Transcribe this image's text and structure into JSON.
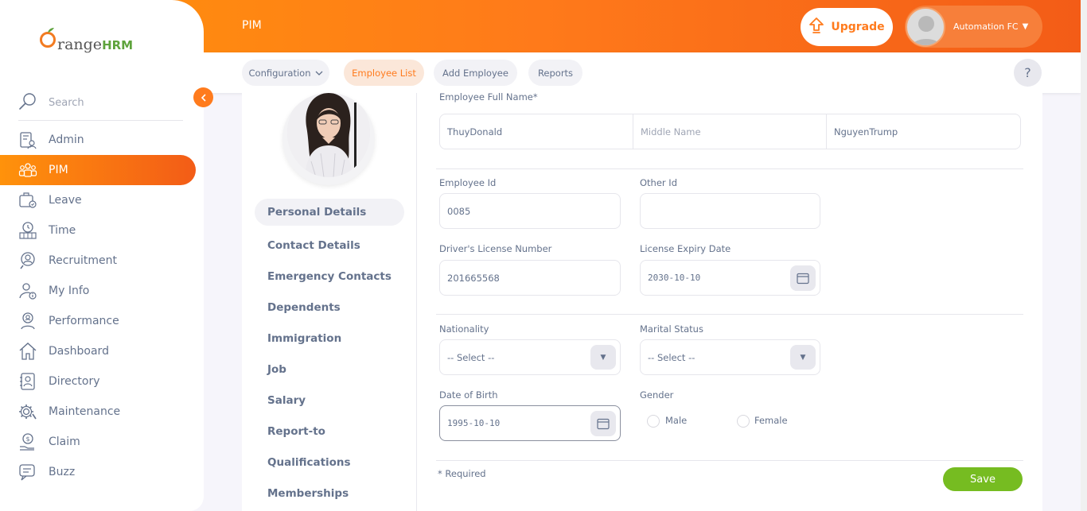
{
  "header": {
    "title": "PIM",
    "upgrade_label": "Upgrade",
    "user_name": "Automation FC"
  },
  "subnav": {
    "configuration": "Configuration",
    "employee_list": "Employee List",
    "add_employee": "Add Employee",
    "reports": "Reports",
    "help": "?"
  },
  "sidebar": {
    "brand": "range",
    "brand_hrm": "HRM",
    "search_placeholder": "Search",
    "items": [
      {
        "label": "Admin"
      },
      {
        "label": "PIM"
      },
      {
        "label": "Leave"
      },
      {
        "label": "Time"
      },
      {
        "label": "Recruitment"
      },
      {
        "label": "My Info"
      },
      {
        "label": "Performance"
      },
      {
        "label": "Dashboard"
      },
      {
        "label": "Directory"
      },
      {
        "label": "Maintenance"
      },
      {
        "label": "Claim"
      },
      {
        "label": "Buzz"
      }
    ]
  },
  "tabs": [
    {
      "label": "Personal Details"
    },
    {
      "label": "Contact Details"
    },
    {
      "label": "Emergency Contacts"
    },
    {
      "label": "Dependents"
    },
    {
      "label": "Immigration"
    },
    {
      "label": "Job"
    },
    {
      "label": "Salary"
    },
    {
      "label": "Report-to"
    },
    {
      "label": "Qualifications"
    },
    {
      "label": "Memberships"
    }
  ],
  "form": {
    "full_name_label": "Employee Full Name*",
    "first_name": "ThuyDonald",
    "middle_name_placeholder": "Middle Name",
    "last_name": "NguyenTrump",
    "employee_id_label": "Employee Id",
    "employee_id": "0085",
    "other_id_label": "Other Id",
    "other_id": "",
    "license_label": "Driver's License Number",
    "license": "201665568",
    "license_expiry_label": "License Expiry Date",
    "license_expiry": "2030-10-10",
    "nationality_label": "Nationality",
    "nationality": "-- Select --",
    "marital_label": "Marital Status",
    "marital": "-- Select --",
    "dob_label": "Date of Birth",
    "dob": "1995-10-10",
    "gender_label": "Gender",
    "male": "Male",
    "female": "Female",
    "required_note": "* Required",
    "save_label": "Save"
  }
}
